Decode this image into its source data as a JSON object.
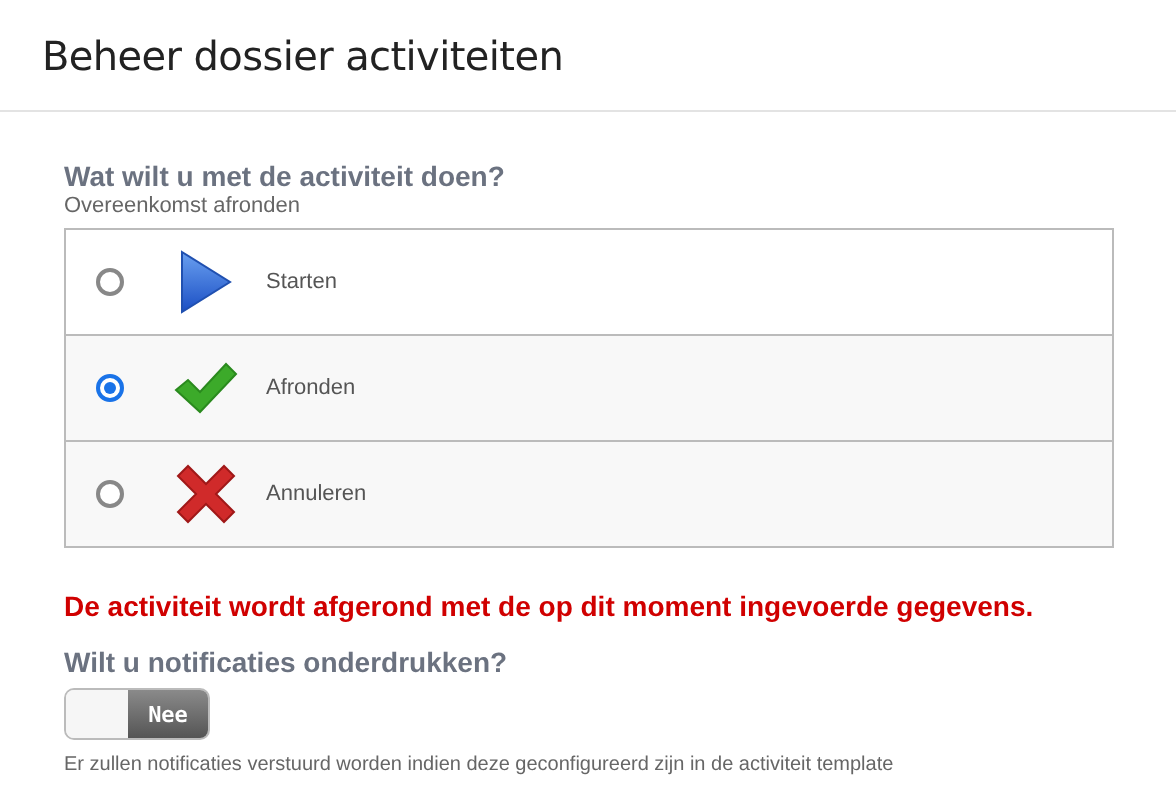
{
  "header": {
    "title": "Beheer dossier activiteiten"
  },
  "question": {
    "label": "Wat wilt u met de activiteit doen?",
    "subtitle": "Overeenkomst afronden"
  },
  "options": [
    {
      "kind": "start",
      "label": "Starten",
      "selected": false
    },
    {
      "kind": "complete",
      "label": "Afronden",
      "selected": true
    },
    {
      "kind": "cancel",
      "label": "Annuleren",
      "selected": false
    }
  ],
  "warning": "De activiteit wordt afgerond met de op dit moment ingevoerde gegevens.",
  "suppress": {
    "label": "Wilt u notificaties onderdrukken?",
    "on": false,
    "state_text": "Nee",
    "note": "Er zullen notificaties verstuurd worden indien deze geconfigureerd zijn in de activiteit template"
  }
}
